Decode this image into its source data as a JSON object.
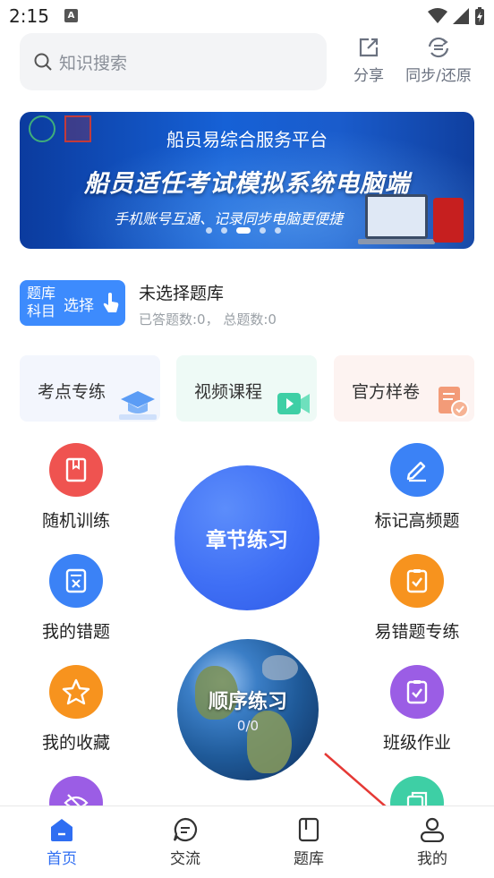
{
  "status_bar": {
    "time": "2:15",
    "app_badge": "A"
  },
  "search": {
    "placeholder": "知识搜索"
  },
  "top_actions": {
    "share": "分享",
    "sync": "同步/还原"
  },
  "banner": {
    "platform": "船员易综合服务平台",
    "title": "船员适任考试模拟系统电脑端",
    "subtitle": "手机账号互通、记录同步电脑更便捷",
    "dots": 5,
    "active_dot": 3
  },
  "question_bank": {
    "tag": "题库科目",
    "choose_label": "选择",
    "title": "未选择题库",
    "stats": "已答题数:0， 总题数:0"
  },
  "cards": [
    {
      "label": "考点专练",
      "icon": "graduation-cap-icon",
      "bg": "#f3f6fd",
      "icon_color": "#5b9cf5"
    },
    {
      "label": "视频课程",
      "icon": "video-camera-icon",
      "bg": "#eefaf6",
      "icon_color": "#3ecfa5"
    },
    {
      "label": "官方样卷",
      "icon": "document-check-icon",
      "bg": "#fdf3f1",
      "icon_color": "#f39b78"
    }
  ],
  "features": {
    "random": {
      "label": "随机训练",
      "color": "#ef5350"
    },
    "mark_frequent": {
      "label": "标记高频题",
      "color": "#3b82f6"
    },
    "my_wrong": {
      "label": "我的错题",
      "color": "#3b82f6"
    },
    "error_prone": {
      "label": "易错题专练",
      "color": "#f7931e"
    },
    "favorites": {
      "label": "我的收藏",
      "color": "#f7931e"
    },
    "class_homework": {
      "label": "班级作业",
      "color": "#9b5de5"
    }
  },
  "chapter": {
    "label": "章节练习"
  },
  "sequence": {
    "label": "顺序练习",
    "progress": "0/0"
  },
  "bottom_nav": [
    {
      "label": "首页",
      "active": true
    },
    {
      "label": "交流",
      "active": false
    },
    {
      "label": "题库",
      "active": false
    },
    {
      "label": "我的",
      "active": false
    }
  ]
}
